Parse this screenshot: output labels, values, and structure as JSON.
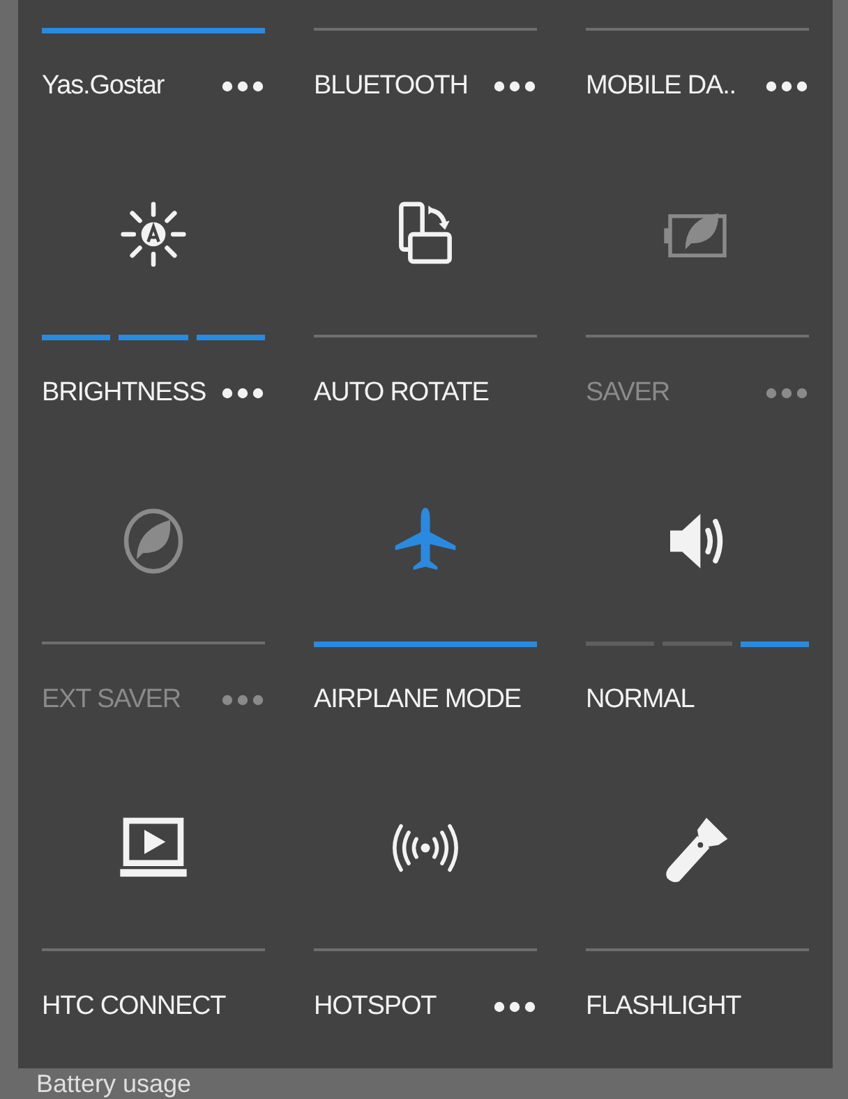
{
  "rows": [
    {
      "tiles": [
        {
          "label": "Yas.Gostar",
          "has_menu": true,
          "disabled": false,
          "indicator": {
            "kind": "bar",
            "on": true
          }
        },
        {
          "label": "BLUETOOTH",
          "has_menu": true,
          "disabled": false,
          "indicator": {
            "kind": "bar",
            "on": false
          }
        },
        {
          "label": "MOBILE DA..",
          "has_menu": true,
          "disabled": false,
          "indicator": {
            "kind": "bar",
            "on": false
          }
        }
      ]
    },
    {
      "tiles": [
        {
          "label": "BRIGHTNESS",
          "has_menu": true,
          "disabled": false,
          "icon_highlighted": false,
          "indicator": {
            "kind": "segments",
            "segments": [
              {
                "on": true
              },
              {
                "on": true
              },
              {
                "on": true
              }
            ]
          }
        },
        {
          "label": "AUTO ROTATE",
          "has_menu": false,
          "disabled": false,
          "icon_highlighted": false,
          "indicator": {
            "kind": "bar",
            "on": false
          }
        },
        {
          "label": "SAVER",
          "has_menu": true,
          "disabled": true,
          "icon_highlighted": false,
          "indicator": {
            "kind": "bar",
            "on": false
          }
        }
      ]
    },
    {
      "tiles": [
        {
          "label": "EXT SAVER",
          "has_menu": true,
          "disabled": true,
          "icon_highlighted": false,
          "indicator": {
            "kind": "bar",
            "on": false
          }
        },
        {
          "label": "AIRPLANE MODE",
          "has_menu": false,
          "disabled": false,
          "icon_highlighted": true,
          "indicator": {
            "kind": "bar",
            "on": true
          }
        },
        {
          "label": "NORMAL",
          "has_menu": false,
          "disabled": false,
          "icon_highlighted": false,
          "indicator": {
            "kind": "segments",
            "segments": [
              {
                "on": false
              },
              {
                "on": false
              },
              {
                "on": true
              }
            ]
          }
        }
      ]
    },
    {
      "tiles": [
        {
          "label": "HTC CONNECT",
          "has_menu": false,
          "disabled": false,
          "icon_highlighted": false,
          "indicator": {
            "kind": "bar",
            "on": false
          }
        },
        {
          "label": "HOTSPOT",
          "has_menu": true,
          "disabled": false,
          "icon_highlighted": false,
          "indicator": {
            "kind": "bar",
            "on": false
          }
        },
        {
          "label": "FLASHLIGHT",
          "has_menu": false,
          "disabled": false,
          "icon_highlighted": false,
          "indicator": {
            "kind": "bar",
            "on": false
          }
        }
      ]
    }
  ],
  "behind_panel": {
    "text": "Battery usage"
  }
}
